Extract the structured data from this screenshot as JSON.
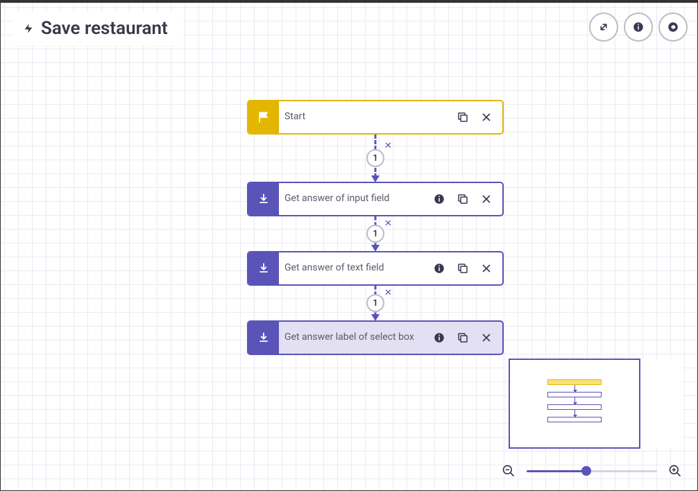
{
  "title": "Save restaurant",
  "nodes": [
    {
      "label": "Start",
      "type": "start",
      "has_info": false
    },
    {
      "label": "Get answer of input field",
      "type": "download",
      "has_info": true
    },
    {
      "label": "Get answer of text field",
      "type": "download",
      "has_info": true
    },
    {
      "label": "Get answer label of select box",
      "type": "download",
      "has_info": true,
      "selected": true
    }
  ],
  "connectors": [
    {
      "label": "1"
    },
    {
      "label": "1"
    },
    {
      "label": "1"
    }
  ],
  "zoom_percent": 46
}
